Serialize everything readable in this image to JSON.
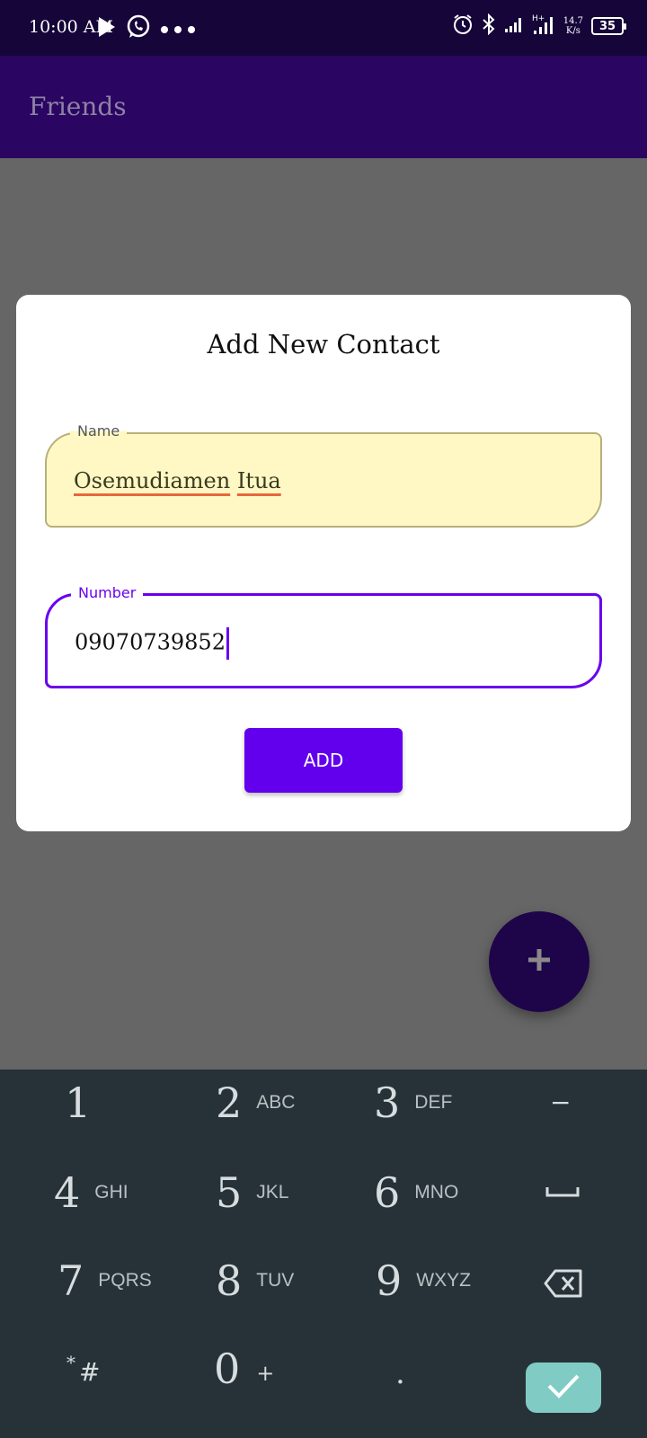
{
  "status_bar": {
    "time": "10:00 AM",
    "network_speed_value": "14.7",
    "network_speed_unit": "K/s",
    "battery": "35"
  },
  "app_bar": {
    "title": "Friends"
  },
  "dialog": {
    "title": "Add New Contact",
    "name_field": {
      "label": "Name",
      "value_first": "Osemudiamen",
      "value_last": "Itua"
    },
    "number_field": {
      "label": "Number",
      "value": "09070739852"
    },
    "add_button_label": "ADD"
  },
  "fab": {
    "icon": "plus-icon"
  },
  "keyboard": {
    "rows": [
      [
        {
          "digit": "1",
          "letters": ""
        },
        {
          "digit": "2",
          "letters": "ABC"
        },
        {
          "digit": "3",
          "letters": "DEF"
        },
        {
          "symbol": "−"
        }
      ],
      [
        {
          "digit": "4",
          "letters": "GHI"
        },
        {
          "digit": "5",
          "letters": "JKL"
        },
        {
          "digit": "6",
          "letters": "MNO"
        },
        {
          "symbol": "space"
        }
      ],
      [
        {
          "digit": "7",
          "letters": "PQRS"
        },
        {
          "digit": "8",
          "letters": "TUV"
        },
        {
          "digit": "9",
          "letters": "WXYZ"
        },
        {
          "symbol": "backspace"
        }
      ],
      [
        {
          "symbol": "*#"
        },
        {
          "digit": "0",
          "letters": "+"
        },
        {
          "symbol": "."
        },
        {
          "symbol": "done"
        }
      ]
    ],
    "key_1": "1",
    "key_2": "2",
    "key_2_letters": "ABC",
    "key_3": "3",
    "key_3_letters": "DEF",
    "key_minus": "−",
    "key_4": "4",
    "key_4_letters": "GHI",
    "key_5": "5",
    "key_5_letters": "JKL",
    "key_6": "6",
    "key_6_letters": "MNO",
    "key_7": "7",
    "key_7_letters": "PQRS",
    "key_8": "8",
    "key_8_letters": "TUV",
    "key_9": "9",
    "key_9_letters": "WXYZ",
    "key_star": "*",
    "key_hash": "#",
    "key_0": "0",
    "key_plus": "+",
    "key_dot": "."
  },
  "colors": {
    "status_bar": "#150538",
    "app_bar": "#2a0561",
    "accent": "#6200ee",
    "name_field_bg": "#fff8c4",
    "keyboard_bg": "#263238",
    "done_key": "#80cbc4"
  }
}
